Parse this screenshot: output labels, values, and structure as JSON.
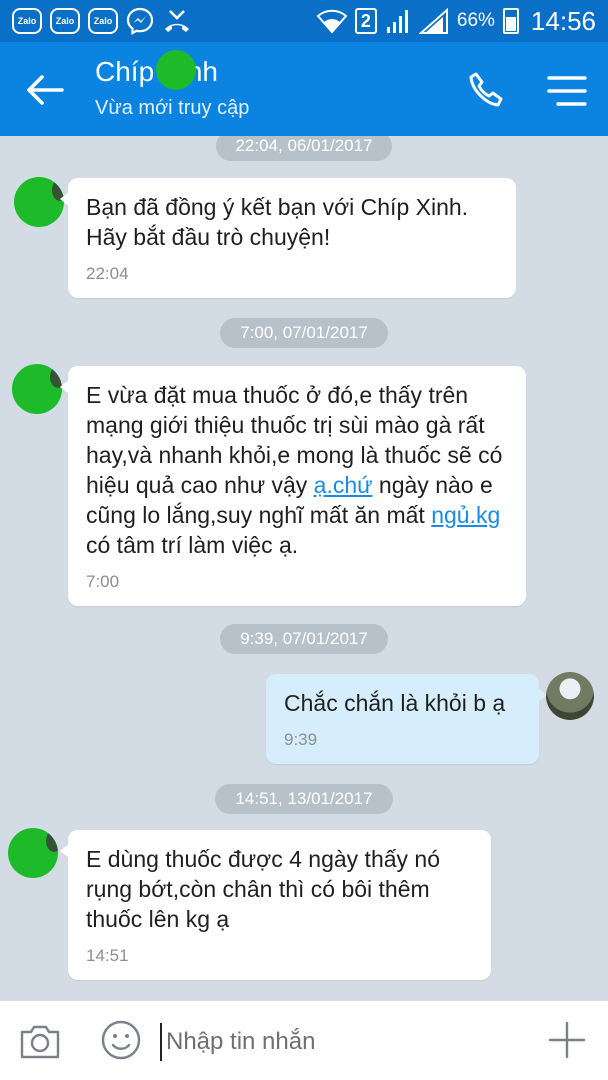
{
  "status_bar": {
    "app_badges": [
      "Zalo",
      "Zalo",
      "Zalo"
    ],
    "sim_slot": "2",
    "battery": "66%",
    "time": "14:56"
  },
  "header": {
    "title": "Chíp Xinh",
    "subtitle": "Vừa mới truy cập"
  },
  "messages": [
    {
      "date": "22:04, 06/01/2017",
      "direction": "in",
      "text": "Bạn đã đồng ý kết bạn với Chíp Xinh. Hãy bắt đầu trò chuyện!",
      "time": "22:04"
    },
    {
      "date": "7:00, 07/01/2017",
      "direction": "in",
      "text_before": "E vừa đặt mua thuốc ở đó,e thấy trên mạng giới thiệu thuốc trị sùi mào gà rất hay,và nhanh khỏi,e mong là thuốc sẽ có hiệu quả cao như vậy ",
      "link1": "ạ.chứ",
      "text_mid": " ngày nào e cũng lo lắng,suy nghĩ mất ăn mất ",
      "link2": "ngủ.kg",
      "text_after": " có tâm trí làm việc ạ.",
      "time": "7:00"
    },
    {
      "date": "9:39, 07/01/2017",
      "direction": "out",
      "text": "Chắc chắn là khỏi b ạ",
      "time": "9:39"
    },
    {
      "date": "14:51, 13/01/2017",
      "direction": "in",
      "text": "E dùng thuốc được 4 ngày thấy nó rụng bớt,còn chân thì có bôi thêm thuốc lên kg ạ",
      "time": "14:51"
    }
  ],
  "input": {
    "placeholder": "Nhập tin nhắn"
  },
  "colors": {
    "status_bar": "#0a6fc6",
    "header": "#0a84e0",
    "chat_bg": "#d3dce4",
    "outgoing_bubble": "#d6eefc",
    "link": "#1b8ae6"
  },
  "icons": [
    "zalo-icon",
    "messenger-icon",
    "missed-call-icon",
    "wifi-icon",
    "signal-icon",
    "battery-icon",
    "back-arrow-icon",
    "phone-icon",
    "menu-icon",
    "camera-icon",
    "emoji-icon",
    "plus-icon"
  ]
}
